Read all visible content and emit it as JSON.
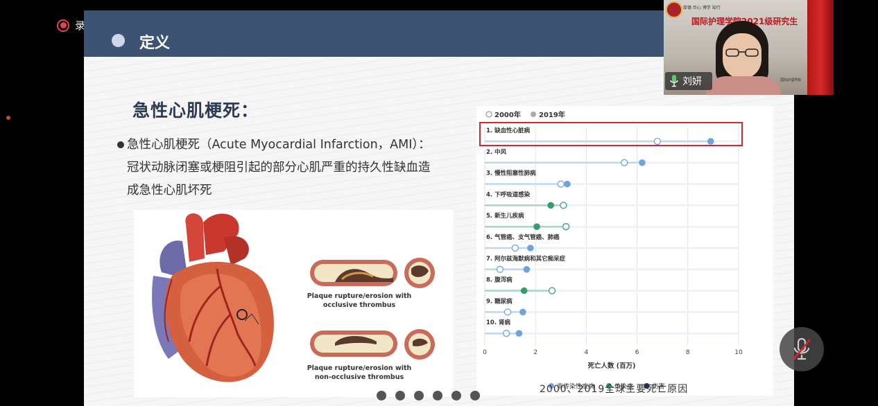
{
  "recording": {
    "label": "录制中"
  },
  "slide": {
    "header_title": "定义",
    "heading": "急性心肌梗死：",
    "definition_line1": "急性心肌梗死（Acute Myocardial Infarction，AMI）：",
    "definition_line2": "冠状动脉闭塞或梗阻引起的部分心肌严重的持久性缺血造",
    "definition_line3": "成急性心肌坏死",
    "figure_caption_1a": "Plaque rupture/erosion with",
    "figure_caption_1b": "occlusive thrombus",
    "figure_caption_2a": "Plaque rupture/erosion with",
    "figure_caption_2b": "non-occlusive thrombus",
    "chart_caption": "2000、2019全球主要死亡原因",
    "page_dots": 6
  },
  "chart_data": {
    "type": "dot-plot",
    "title": "",
    "legend_years": [
      "2000年",
      "2019年"
    ],
    "xlabel": "死亡人数 (百万)",
    "xlim": [
      0,
      10
    ],
    "xticks": [
      0,
      2,
      4,
      6,
      8,
      10
    ],
    "categories": [
      {
        "label": "1. 缺血性心脏病",
        "v2000": 6.8,
        "v2019": 8.9,
        "group": "noncommunicable",
        "highlighted": true
      },
      {
        "label": "2. 中风",
        "v2000": 5.5,
        "v2019": 6.2,
        "group": "noncommunicable"
      },
      {
        "label": "3. 慢性阻塞性肺病",
        "v2000": 3.0,
        "v2019": 3.25,
        "group": "noncommunicable"
      },
      {
        "label": "4. 下呼吸道感染",
        "v2000": 3.1,
        "v2019": 2.6,
        "group": "communicable"
      },
      {
        "label": "5. 新生儿疾病",
        "v2000": 3.2,
        "v2019": 2.05,
        "group": "communicable"
      },
      {
        "label": "6. 气管癌、支气管癌、肺癌",
        "v2000": 1.2,
        "v2019": 1.8,
        "group": "noncommunicable"
      },
      {
        "label": "7. 阿尔兹海默病和其它痴呆症",
        "v2000": 0.6,
        "v2019": 1.65,
        "group": "noncommunicable"
      },
      {
        "label": "8. 腹泻病",
        "v2000": 2.65,
        "v2019": 1.55,
        "group": "communicable"
      },
      {
        "label": "9. 糖尿病",
        "v2000": 0.9,
        "v2019": 1.5,
        "group": "noncommunicable"
      },
      {
        "label": "10. 肾病",
        "v2000": 0.85,
        "v2019": 1.35,
        "group": "noncommunicable"
      }
    ],
    "groups": [
      {
        "key": "noncommunicable",
        "name": "非传染性疾病",
        "color": "#6fa3dc"
      },
      {
        "key": "communicable",
        "name": "传染病",
        "color": "#3a9a6e"
      },
      {
        "key": "injury",
        "name": "伤害",
        "color": "#1f2f5a"
      }
    ],
    "highlight_color": "#d9262c",
    "legend_position": "top-left"
  },
  "video": {
    "participant_name": "刘妍",
    "banner_text": "国际护理学院2021级研究生",
    "banner_top": "厚德  尽心  博学  知行",
    "corner_text": "国际护理学院"
  },
  "colors": {
    "header": "#3d5374",
    "record_red": "#e8424c"
  }
}
